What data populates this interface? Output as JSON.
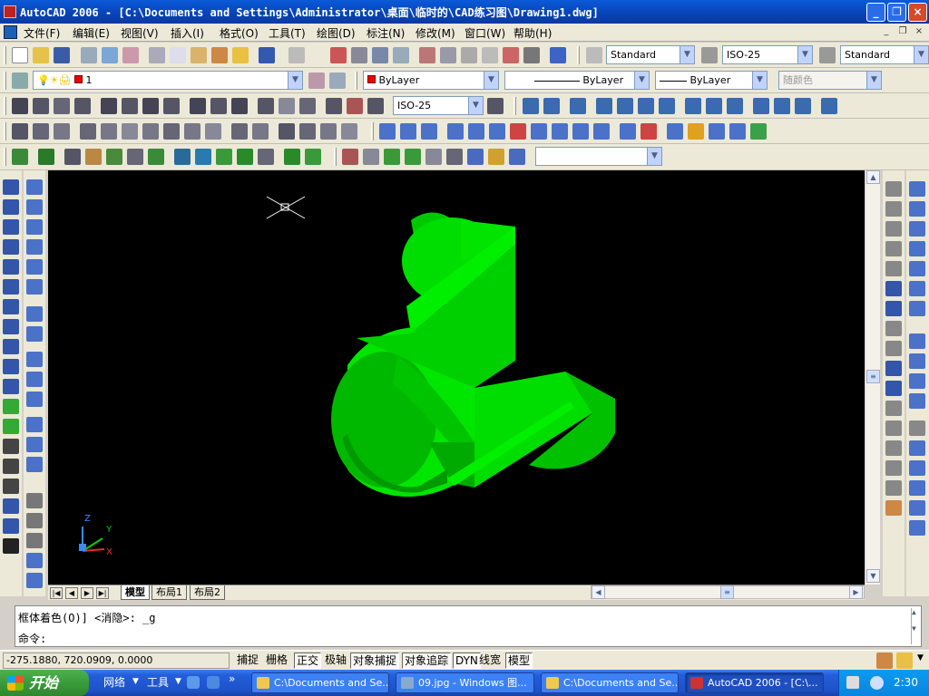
{
  "window": {
    "title": "AutoCAD 2006 - [C:\\Documents and Settings\\Administrator\\桌面\\临时的\\CAD练习图\\Drawing1.dwg]",
    "minimize": "_",
    "restore": "❐",
    "close": "×"
  },
  "menu": [
    "文件(F)",
    "编辑(E)",
    "视图(V)",
    "插入(I)",
    "格式(O)",
    "工具(T)",
    "绘图(D)",
    "标注(N)",
    "修改(M)",
    "窗口(W)",
    "帮助(H)"
  ],
  "toolbars": {
    "text_style": "Standard",
    "dim_style": "ISO-25",
    "table_style": "Standard",
    "layer": "1",
    "color": "ByLayer",
    "linetype": "ByLayer",
    "lineweight": "ByLayer",
    "plot_style": "随颜色",
    "dim_style2": "ISO-25",
    "view_combo": ""
  },
  "layout_tabs": [
    "模型",
    "布局1",
    "布局2"
  ],
  "ucs": {
    "z": "Z",
    "y": "Y",
    "x": "X"
  },
  "command": {
    "history": "框体着色(O)] <消隐>: _g",
    "prompt": "命令:"
  },
  "status": {
    "coords": "-275.1880, 720.0909, 0.0000",
    "toggles": [
      "捕捉",
      "栅格",
      "正交",
      "极轴",
      "对象捕捉",
      "对象追踪",
      "DYN",
      "线宽",
      "模型"
    ]
  },
  "taskbar": {
    "start": "开始",
    "quicklaunch": [
      "网络",
      "工具"
    ],
    "tasks": [
      "C:\\Documents and Se...",
      "09.jpg - Windows 图...",
      "C:\\Documents and Se...",
      "AutoCAD 2006 - [C:\\..."
    ],
    "clock": "2:30"
  },
  "colors": {
    "model_green": "#00e400",
    "canvas": "#000000",
    "titlebar": "#0a5bd8"
  }
}
